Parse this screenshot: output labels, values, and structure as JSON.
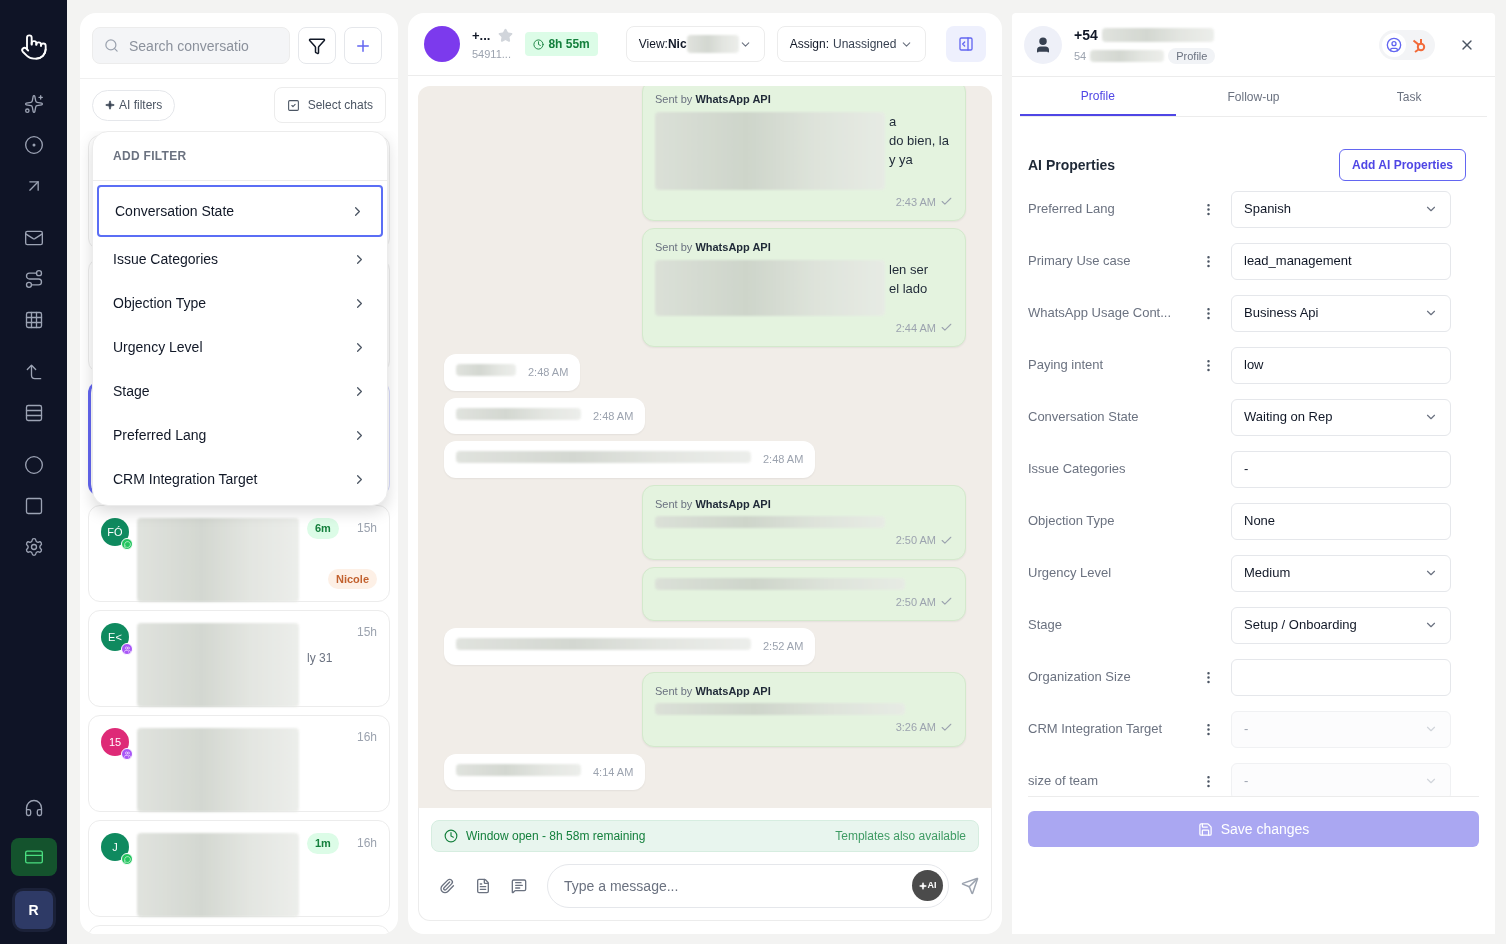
{
  "nav": {
    "items": [
      {
        "kind": "logo",
        "selected": false
      },
      {
        "kind": "sparkles",
        "selected": false
      },
      {
        "kind": "target",
        "selected": false
      },
      {
        "kind": "arrow",
        "selected": false
      },
      {
        "kind": "mail",
        "selected": false
      },
      {
        "kind": "route",
        "selected": false
      },
      {
        "kind": "grid",
        "selected": false
      },
      {
        "kind": "corner",
        "selected": false
      },
      {
        "kind": "rows",
        "selected": false
      },
      {
        "kind": "circle",
        "selected": false
      },
      {
        "kind": "square",
        "selected": false
      },
      {
        "kind": "settings",
        "selected": false
      }
    ],
    "bottom_items": [
      {
        "kind": "headphones",
        "selected": false
      },
      {
        "kind": "card",
        "selected": true
      }
    ],
    "avatar": "R"
  },
  "conversations_panel": {
    "search": {
      "placeholder": "Search conversatio"
    },
    "ai_filters": "AI filters",
    "select_chats": "Select chats",
    "filter_menu": {
      "title": "ADD FILTER",
      "items": [
        {
          "label": "Conversation State",
          "selected": true
        },
        {
          "label": "Issue Categories",
          "selected": false
        },
        {
          "label": "Objection Type",
          "selected": false
        },
        {
          "label": "Urgency Level",
          "selected": false
        },
        {
          "label": "Stage",
          "selected": false
        },
        {
          "label": "Preferred Lang",
          "selected": false
        },
        {
          "label": "CRM Integration Target",
          "selected": false
        }
      ]
    },
    "conversations": [
      {
        "initials": "FÓ",
        "color": "#0f8a5f",
        "kind": "whatsapp",
        "timer": "6m",
        "time": "15h",
        "tag": "Nicole"
      },
      {
        "initials": "E<",
        "color": "#0f8a5f",
        "kind": "team",
        "time": "15h",
        "snippet": "ly 31"
      },
      {
        "initials": "15",
        "color": "#de2a77",
        "kind": "team",
        "time": "16h"
      },
      {
        "initials": "J",
        "color": "#0f8a5f",
        "kind": "whatsapp",
        "timer": "1m",
        "time": "16h"
      }
    ]
  },
  "chat": {
    "contact": {
      "name": "+...",
      "starred": false,
      "phone": "54911..."
    },
    "timer": "8h 55m",
    "view": {
      "label": "View:",
      "value": "Nic"
    },
    "assign": {
      "label": "Assign:",
      "value": "Unassigned"
    },
    "messages": [
      {
        "kind": "outgoing",
        "sender_prefix": "Sent by",
        "sender": "WhatsApp API",
        "lines": [
          "a",
          "do bien, la",
          "y ya"
        ],
        "time": "2:43 AM",
        "delivered": true
      },
      {
        "kind": "outgoing",
        "sender_prefix": "Sent by",
        "sender": "WhatsApp API",
        "lines": [
          "len ser",
          "el lado"
        ],
        "time": "2:44 AM",
        "delivered": true
      },
      {
        "kind": "incoming",
        "time": "2:48 AM"
      },
      {
        "kind": "incoming",
        "time": "2:48 AM"
      },
      {
        "kind": "incoming",
        "time": "2:48 AM"
      },
      {
        "kind": "outgoing",
        "sender_prefix": "Sent by",
        "sender": "WhatsApp API",
        "time": "2:50 AM",
        "delivered": true
      },
      {
        "kind": "outgoing",
        "time": "2:50 AM",
        "delivered": true
      },
      {
        "kind": "incoming",
        "time": "2:52 AM"
      },
      {
        "kind": "outgoing",
        "sender_prefix": "Sent by",
        "sender": "WhatsApp API",
        "time": "3:26 AM",
        "delivered": true
      },
      {
        "kind": "incoming",
        "time": "4:14 AM"
      }
    ],
    "window_banner": {
      "status": "Window open - 8h 58m remaining",
      "note": "Templates also available"
    },
    "composer": {
      "placeholder": "Type a message...",
      "ai": "AI"
    }
  },
  "profile": {
    "name": "+54",
    "phone": "54",
    "badge": "Profile",
    "tabs": [
      {
        "label": "Profile",
        "selected": true
      },
      {
        "label": "Follow-up",
        "selected": false
      },
      {
        "label": "Task",
        "selected": false
      }
    ],
    "section_title": "AI Properties",
    "add_button": "Add AI Properties",
    "properties": [
      {
        "label": "Preferred Lang",
        "menu": true,
        "kind": "select",
        "value": "Spanish",
        "disabled": false
      },
      {
        "label": "Primary Use case",
        "menu": true,
        "kind": "text",
        "value": "lead_management",
        "disabled": false
      },
      {
        "label": "WhatsApp Usage Cont...",
        "menu": true,
        "kind": "select",
        "value": "Business Api",
        "disabled": false
      },
      {
        "label": "Paying intent",
        "menu": true,
        "kind": "text",
        "value": "low",
        "disabled": false
      },
      {
        "label": "Conversation State",
        "menu": false,
        "kind": "select",
        "value": "Waiting on Rep",
        "disabled": false
      },
      {
        "label": "Issue Categories",
        "menu": false,
        "kind": "text",
        "value": "-",
        "disabled": false
      },
      {
        "label": "Objection Type",
        "menu": false,
        "kind": "text",
        "value": "None",
        "disabled": false
      },
      {
        "label": "Urgency Level",
        "menu": false,
        "kind": "select",
        "value": "Medium",
        "disabled": false
      },
      {
        "label": "Stage",
        "menu": false,
        "kind": "select",
        "value": "Setup / Onboarding",
        "disabled": false
      },
      {
        "label": "Organization Size",
        "menu": true,
        "kind": "text",
        "disabled": false
      },
      {
        "label": "CRM Integration Target",
        "menu": true,
        "kind": "select",
        "value": "-",
        "disabled": true
      },
      {
        "label": "size of team",
        "menu": true,
        "kind": "select",
        "value": "-",
        "disabled": true
      }
    ],
    "save_button": {
      "label": "Save changes",
      "disabled": true
    }
  }
}
